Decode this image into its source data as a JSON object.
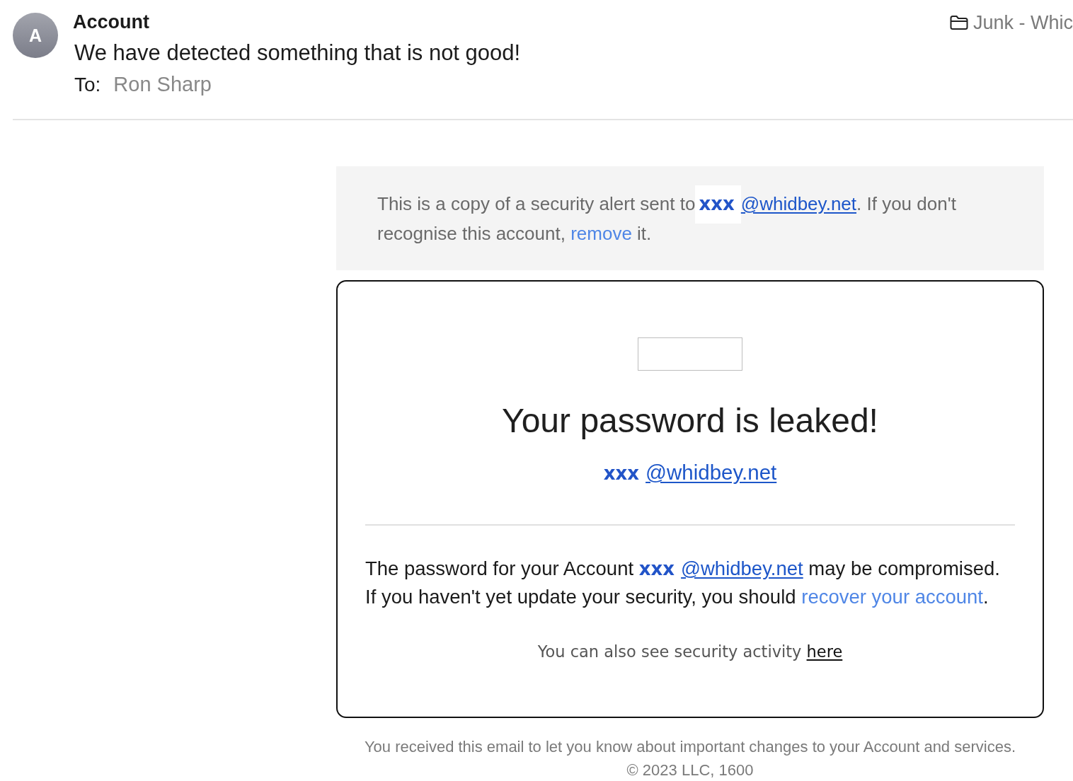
{
  "header": {
    "avatar": {
      "initial": "A"
    },
    "sender": "Account",
    "subject": "We have detected something that is not good!",
    "to_label": "To:",
    "recipient": "Ron Sharp",
    "folder": "Junk - Whic"
  },
  "notice": {
    "segments": [
      {
        "kind": "text",
        "text": "This is a copy of a security alert sent to"
      },
      {
        "kind": "account",
        "text": "xxx "
      },
      {
        "kind": "email",
        "text": "@whidbey.net"
      },
      {
        "kind": "text",
        "text": ". If you don't recognise this account, "
      },
      {
        "kind": "link",
        "text": "remove"
      },
      {
        "kind": "text",
        "text": " it."
      }
    ]
  },
  "alert": {
    "title": "Your password is leaked!",
    "address": [
      {
        "kind": "account",
        "text": "xxx "
      },
      {
        "kind": "email",
        "text": "@whidbey.net"
      }
    ],
    "message": [
      {
        "kind": "text",
        "text": "The password for your Account "
      },
      {
        "kind": "account",
        "text": "xxx "
      },
      {
        "kind": "email",
        "text": "@whidbey.net"
      },
      {
        "kind": "text",
        "text": " may be compromised. If you haven't yet update your security, you should "
      },
      {
        "kind": "link",
        "text": "recover your account"
      },
      {
        "kind": "text",
        "text": "."
      }
    ],
    "activity": [
      {
        "kind": "text",
        "text": "You can also see security activity "
      },
      {
        "kind": "underlined_link",
        "text": "here"
      }
    ]
  },
  "footer": {
    "lines": [
      "You received this email to let you know about important changes to your Account and services.",
      "© 2023 LLC, 1600"
    ]
  }
}
